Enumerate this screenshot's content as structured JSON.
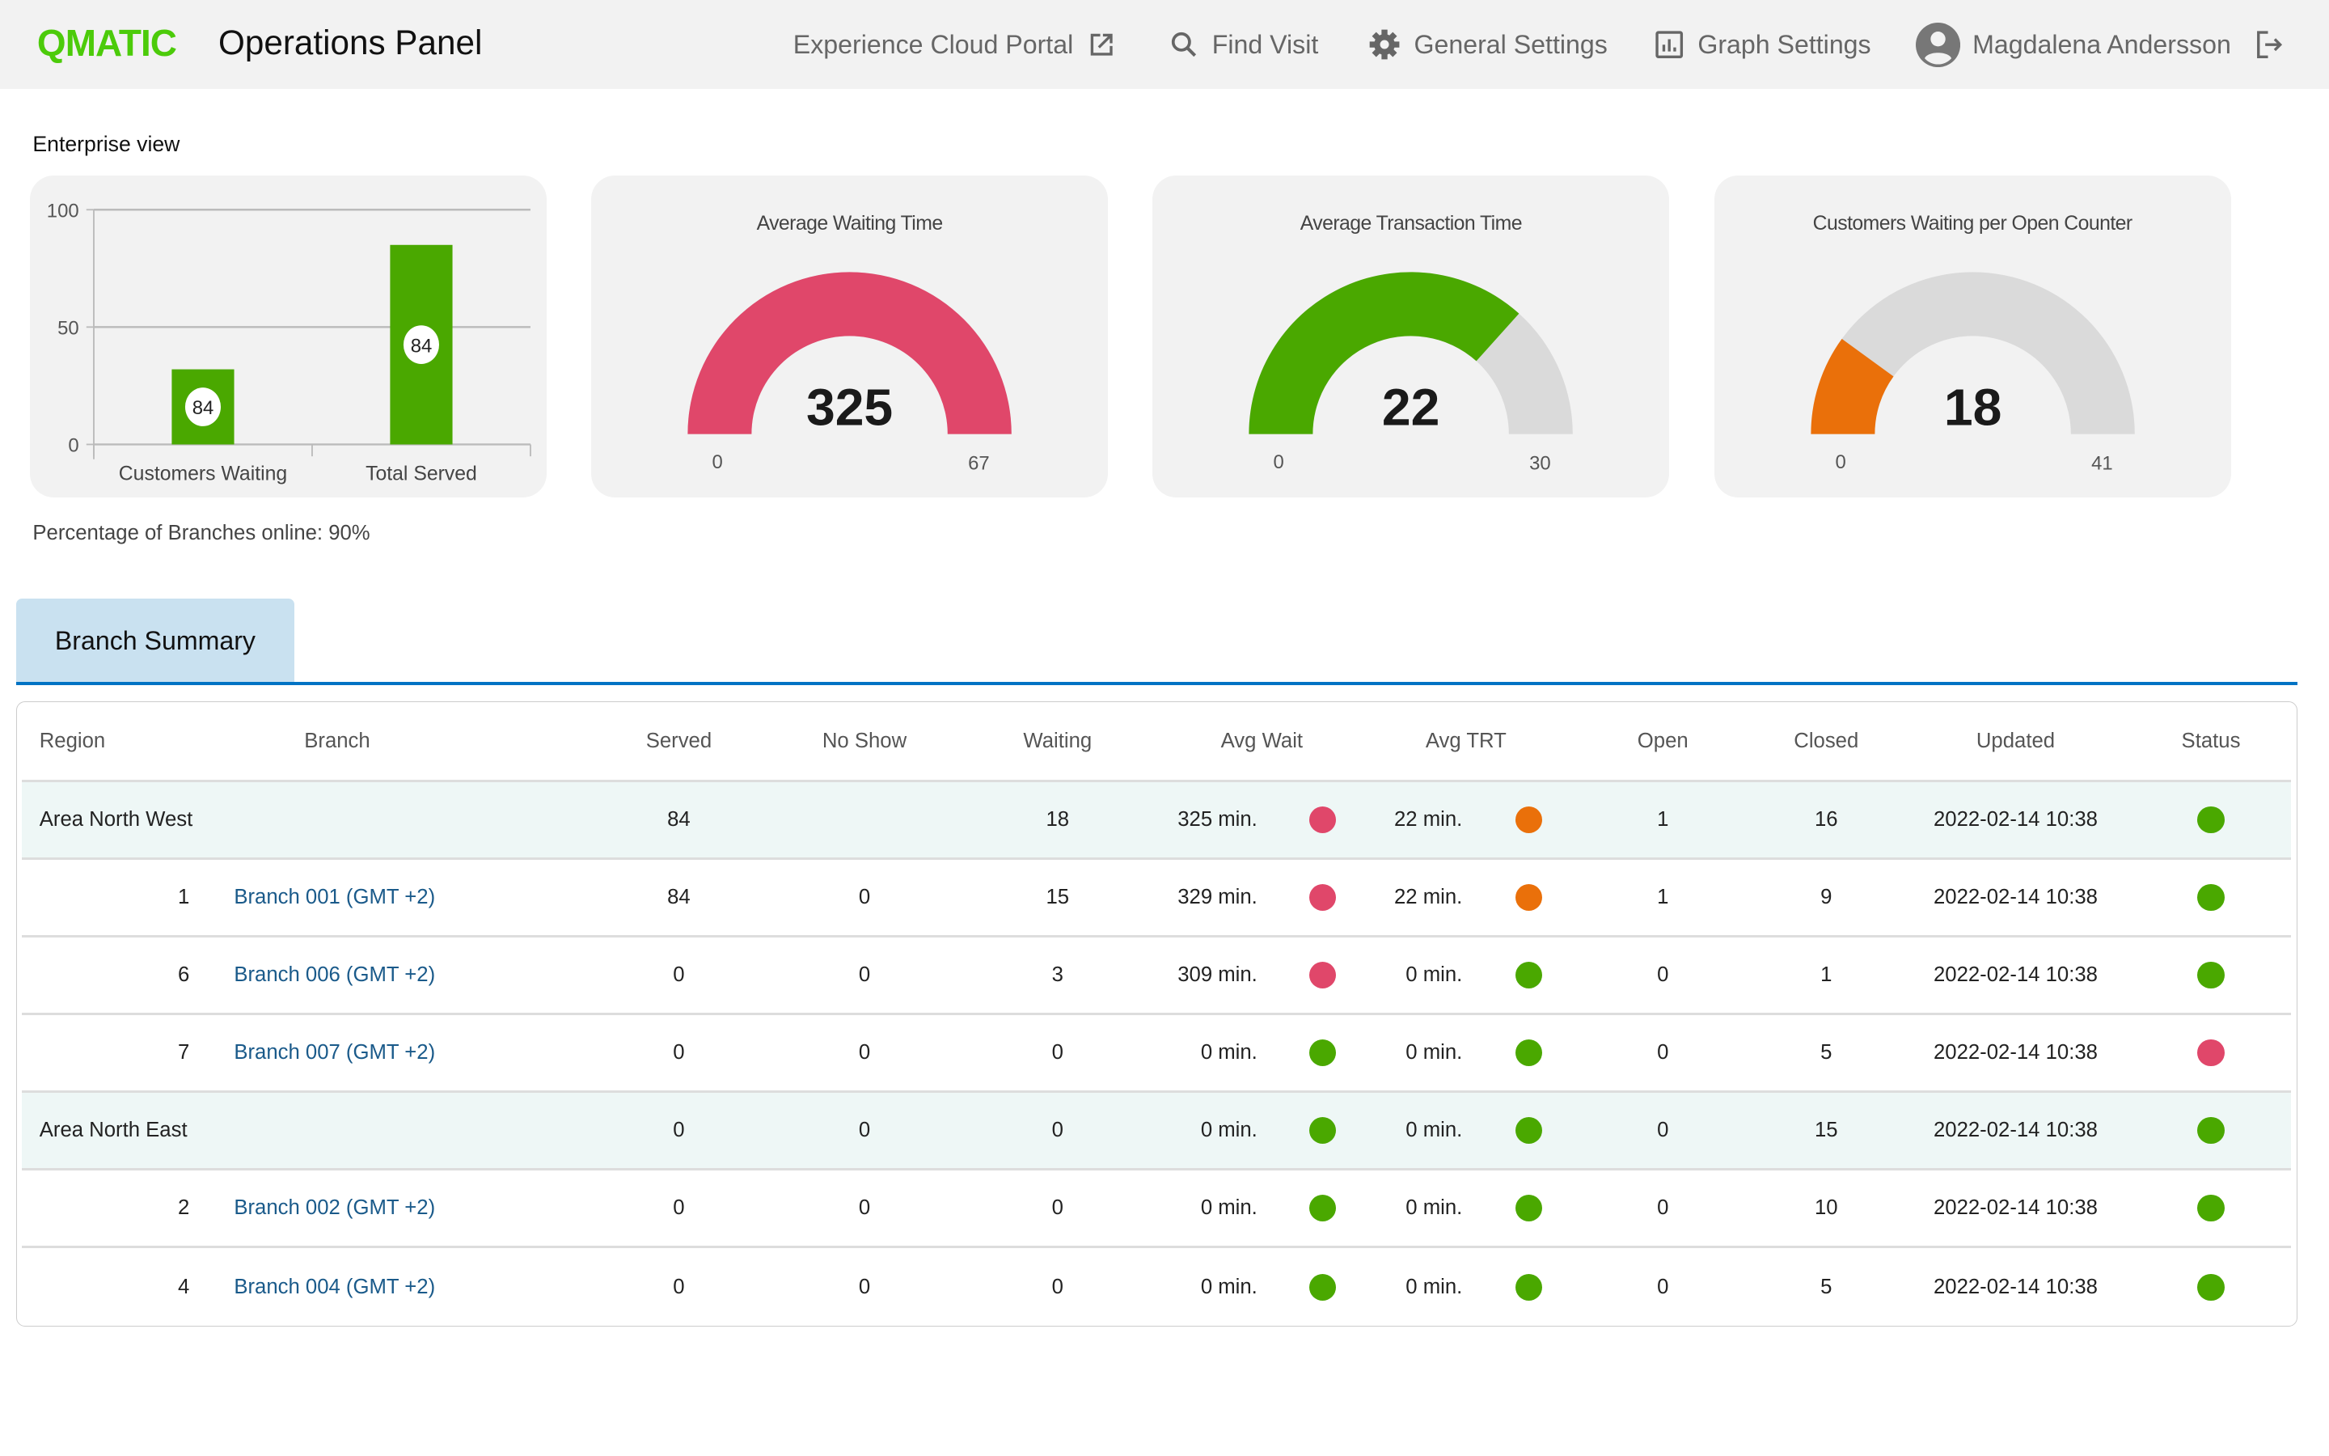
{
  "header": {
    "logo": "QMATIC",
    "title": "Operations Panel",
    "nav": [
      {
        "label": "Experience Cloud Portal",
        "icon": "external-link-icon"
      },
      {
        "label": "Find Visit",
        "icon": "search-icon"
      },
      {
        "label": "General Settings",
        "icon": "gear-icon"
      },
      {
        "label": "Graph Settings",
        "icon": "bar-chart-icon"
      },
      {
        "label": "Magdalena Andersson",
        "icon": "user-avatar-icon"
      }
    ],
    "logout_icon": "logout-icon"
  },
  "section_title": "Enterprise view",
  "colors": {
    "brand": "#4ccb0a",
    "bar": "#4aa800",
    "red": "#e0476a",
    "orange": "#ea700a",
    "green": "#4aa800",
    "track": "#dadada",
    "accent": "#0073c4"
  },
  "chart_data": [
    {
      "type": "bar",
      "categories": [
        "Customers Waiting",
        "Total Served"
      ],
      "values": [
        32,
        85
      ],
      "data_labels": [
        "84",
        "84"
      ],
      "ylim": [
        0,
        100
      ],
      "yticks": [
        "0",
        "50",
        "100"
      ],
      "grid": true
    },
    {
      "type": "gauge",
      "title": "Average Waiting Time",
      "value": "325",
      "min": "0",
      "max": "67",
      "fill": 1.0,
      "color": "#e0476a"
    },
    {
      "type": "gauge",
      "title": "Average Transaction Time",
      "value": "22",
      "min": "0",
      "max": "30",
      "fill": 0.733,
      "color": "#4aa800"
    },
    {
      "type": "gauge",
      "title": "Customers Waiting per Open Counter",
      "value": "18",
      "min": "0",
      "max": "41",
      "fill": 0.2,
      "color": "#ea700a"
    }
  ],
  "branches_online": "Percentage of Branches online: 90%",
  "tab": "Branch Summary",
  "table": {
    "columns": [
      "Region",
      "Branch",
      "Served",
      "No Show",
      "Waiting",
      "Avg Wait",
      "Avg TRT",
      "Open",
      "Closed",
      "Updated",
      "Status"
    ],
    "rows": [
      {
        "type": "region",
        "region": "Area North West",
        "branch": "",
        "served": "84",
        "noshow": "",
        "waiting": "18",
        "avgwait": "325 min.",
        "avgwait_status": "red",
        "avgtrt": "22 min.",
        "avgtrt_status": "orange",
        "open": "1",
        "closed": "16",
        "updated": "2022-02-14 10:38",
        "status": "green"
      },
      {
        "type": "branch",
        "region": "1",
        "branch": "Branch 001 (GMT +2)",
        "served": "84",
        "noshow": "0",
        "waiting": "15",
        "avgwait": "329 min.",
        "avgwait_status": "red",
        "avgtrt": "22 min.",
        "avgtrt_status": "orange",
        "open": "1",
        "closed": "9",
        "updated": "2022-02-14 10:38",
        "status": "green"
      },
      {
        "type": "branch",
        "region": "6",
        "branch": "Branch 006 (GMT +2)",
        "served": "0",
        "noshow": "0",
        "waiting": "3",
        "avgwait": "309 min.",
        "avgwait_status": "red",
        "avgtrt": "0 min.",
        "avgtrt_status": "green",
        "open": "0",
        "closed": "1",
        "updated": "2022-02-14 10:38",
        "status": "green"
      },
      {
        "type": "branch",
        "region": "7",
        "branch": "Branch 007 (GMT +2)",
        "served": "0",
        "noshow": "0",
        "waiting": "0",
        "avgwait": "0 min.",
        "avgwait_status": "green",
        "avgtrt": "0 min.",
        "avgtrt_status": "green",
        "open": "0",
        "closed": "5",
        "updated": "2022-02-14 10:38",
        "status": "red"
      },
      {
        "type": "region",
        "region": "Area North East",
        "branch": "",
        "served": "0",
        "noshow": "0",
        "waiting": "0",
        "avgwait": "0 min.",
        "avgwait_status": "green",
        "avgtrt": "0 min.",
        "avgtrt_status": "green",
        "open": "0",
        "closed": "15",
        "updated": "2022-02-14 10:38",
        "status": "green"
      },
      {
        "type": "branch",
        "region": "2",
        "branch": "Branch 002 (GMT +2)",
        "served": "0",
        "noshow": "0",
        "waiting": "0",
        "avgwait": "0 min.",
        "avgwait_status": "green",
        "avgtrt": "0 min.",
        "avgtrt_status": "green",
        "open": "0",
        "closed": "10",
        "updated": "2022-02-14 10:38",
        "status": "green"
      },
      {
        "type": "branch",
        "region": "4",
        "branch": "Branch 004 (GMT +2)",
        "served": "0",
        "noshow": "0",
        "waiting": "0",
        "avgwait": "0 min.",
        "avgwait_status": "green",
        "avgtrt": "0 min.",
        "avgtrt_status": "green",
        "open": "0",
        "closed": "5",
        "updated": "2022-02-14 10:38",
        "status": "green"
      }
    ]
  }
}
